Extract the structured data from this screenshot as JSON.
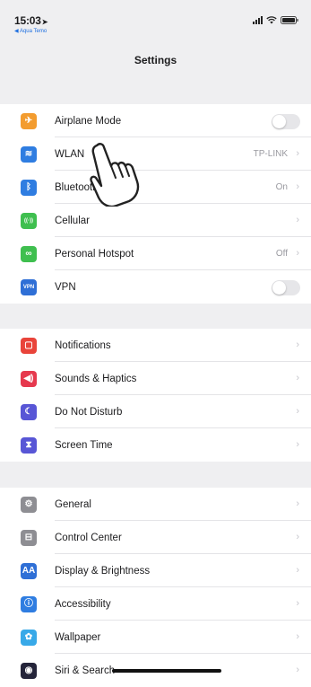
{
  "status": {
    "time": "15:03",
    "location_arrow": "➤",
    "back_app": "◀ Aqua Temo",
    "icons": [
      "signal-icon",
      "wifi-icon",
      "battery-icon"
    ]
  },
  "nav": {
    "title": "Settings"
  },
  "group1": [
    {
      "name": "airplane-mode",
      "label": "Airplane Mode",
      "icon": "airplane-icon",
      "color": "#f39c2f",
      "glyph": "✈",
      "accessory": "toggle",
      "toggle_on": false
    },
    {
      "name": "wlan",
      "label": "WLAN",
      "icon": "wifi-icon",
      "color": "#2f7de1",
      "glyph": "≋",
      "accessory": "value",
      "value": "TP-LINK"
    },
    {
      "name": "bluetooth",
      "label": "Bluetooth",
      "icon": "bluetooth-icon",
      "color": "#2f7de1",
      "glyph": "ᛒ",
      "accessory": "value",
      "value": "On"
    },
    {
      "name": "cellular",
      "label": "Cellular",
      "icon": "cellular-icon",
      "color": "#3fbf4f",
      "glyph": "((·))",
      "accessory": "chevron"
    },
    {
      "name": "personal-hotspot",
      "label": "Personal Hotspot",
      "icon": "hotspot-icon",
      "color": "#3fbf4f",
      "glyph": "∞",
      "accessory": "value",
      "value": "Off"
    },
    {
      "name": "vpn",
      "label": "VPN",
      "icon": "vpn-icon",
      "color": "#2f6fd6",
      "glyph": "VPN",
      "accessory": "toggle",
      "toggle_on": false
    }
  ],
  "group2": [
    {
      "name": "notifications",
      "label": "Notifications",
      "icon": "notifications-icon",
      "color": "#e9443a",
      "glyph": "▢",
      "accessory": "chevron"
    },
    {
      "name": "sounds-haptics",
      "label": "Sounds & Haptics",
      "icon": "speaker-icon",
      "color": "#e6394e",
      "glyph": "◀)",
      "accessory": "chevron"
    },
    {
      "name": "do-not-disturb",
      "label": "Do Not Disturb",
      "icon": "moon-icon",
      "color": "#5856d6",
      "glyph": "☾",
      "accessory": "chevron"
    },
    {
      "name": "screen-time",
      "label": "Screen Time",
      "icon": "hourglass-icon",
      "color": "#5856d6",
      "glyph": "⧗",
      "accessory": "chevron"
    }
  ],
  "group3": [
    {
      "name": "general",
      "label": "General",
      "icon": "gear-icon",
      "color": "#8e8e93",
      "glyph": "⚙",
      "accessory": "chevron"
    },
    {
      "name": "control-center",
      "label": "Control Center",
      "icon": "control-center-icon",
      "color": "#8e8e93",
      "glyph": "⊟",
      "accessory": "chevron"
    },
    {
      "name": "display-brightness",
      "label": "Display & Brightness",
      "icon": "display-icon",
      "color": "#2f6fd6",
      "glyph": "AA",
      "accessory": "chevron"
    },
    {
      "name": "accessibility",
      "label": "Accessibility",
      "icon": "accessibility-icon",
      "color": "#2f7de1",
      "glyph": "ⓘ",
      "accessory": "chevron"
    },
    {
      "name": "wallpaper",
      "label": "Wallpaper",
      "icon": "wallpaper-icon",
      "color": "#38a9e8",
      "glyph": "✿",
      "accessory": "chevron"
    },
    {
      "name": "siri-search",
      "label": "Siri & Search",
      "icon": "siri-icon",
      "color": "#24243a",
      "glyph": "◉",
      "accessory": "chevron"
    }
  ],
  "chevron_glyph": "›"
}
